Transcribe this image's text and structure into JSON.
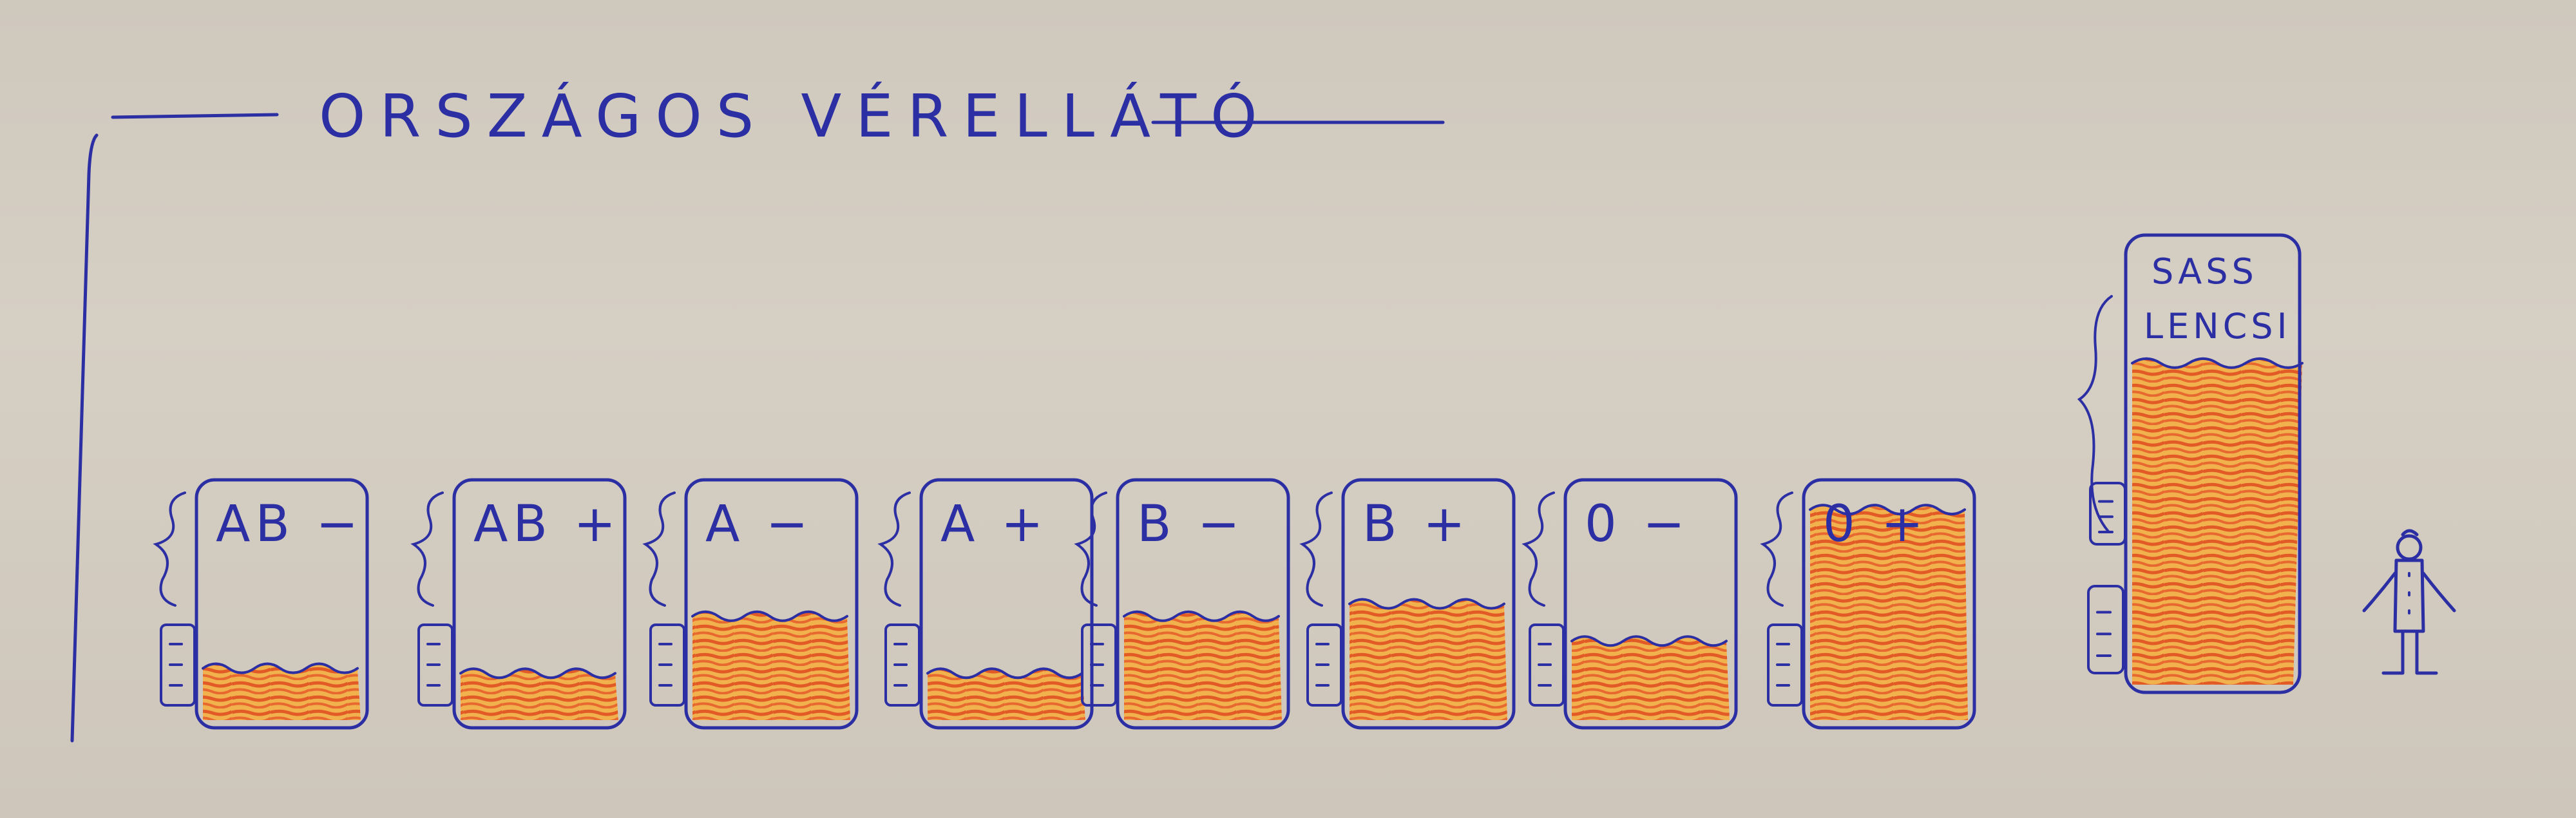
{
  "title": "ORSZÁGOS VÉRELLÁTÓ",
  "bags": [
    {
      "label": "AB −",
      "fill_level": 0.24
    },
    {
      "label": "AB +",
      "fill_level": 0.22
    },
    {
      "label": "A −",
      "fill_level": 0.45
    },
    {
      "label": "A +",
      "fill_level": 0.22
    },
    {
      "label": "B −",
      "fill_level": 0.45
    },
    {
      "label": "B +",
      "fill_level": 0.5
    },
    {
      "label": "0 −",
      "fill_level": 0.35
    },
    {
      "label": "0 +",
      "fill_level": 0.88
    }
  ],
  "big_bag": {
    "label_line1": "SASS",
    "label_line2": "LENCSI",
    "fill_level": 0.72
  },
  "colors": {
    "ink": "#2b2fa3",
    "fill_orange": "#e0652b",
    "fill_yellow": "#f0b24a",
    "paper": "#d3ccc1"
  },
  "icons": [
    "bracket-icon",
    "tag-icon",
    "person-icon"
  ]
}
